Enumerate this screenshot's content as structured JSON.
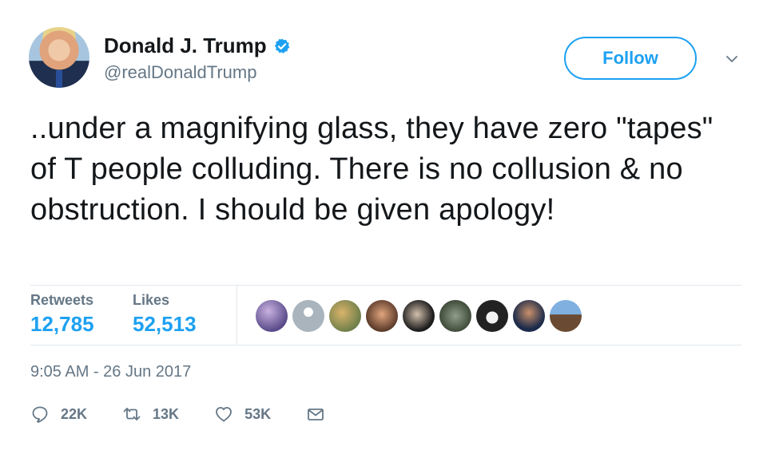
{
  "user": {
    "display_name": "Donald J. Trump",
    "handle": "@realDonaldTrump",
    "verified": true,
    "follow_label": "Follow"
  },
  "tweet": {
    "text": "..under a magnifying glass, they have zero \"tapes\" of T people colluding. There is no collusion & no obstruction. I should be given apology!",
    "timestamp": "9:05 AM - 26 Jun 2017"
  },
  "stats": {
    "retweets_label": "Retweets",
    "retweets_value": "12,785",
    "likes_label": "Likes",
    "likes_value": "52,513"
  },
  "liked_by_avatars": 9,
  "actions": {
    "reply_count": "22K",
    "retweet_count": "13K",
    "like_count": "53K"
  },
  "colors": {
    "accent": "#1da1f2",
    "text": "#14171a",
    "muted": "#657786",
    "divider": "#e1e8ed"
  },
  "icons": {
    "verified": "verified-badge-icon",
    "caret": "chevron-down-icon",
    "reply": "reply-icon",
    "retweet": "retweet-icon",
    "like": "heart-icon",
    "dm": "envelope-icon"
  }
}
